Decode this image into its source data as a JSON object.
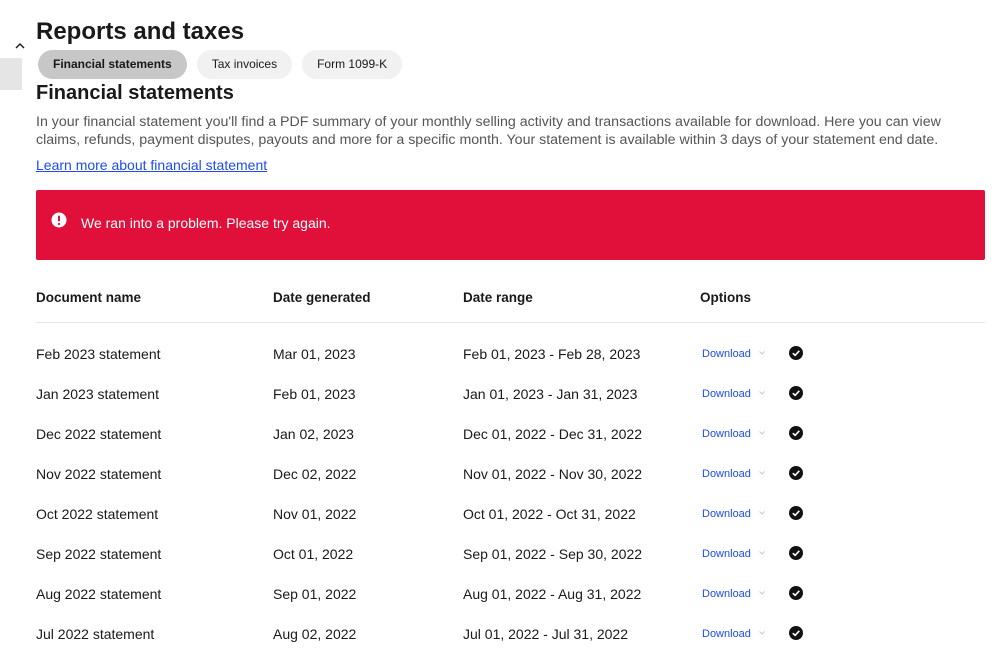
{
  "page": {
    "title": "Reports and taxes"
  },
  "tabs": [
    {
      "label": "Financial statements",
      "active": true
    },
    {
      "label": "Tax invoices",
      "active": false
    },
    {
      "label": "Form 1099-K",
      "active": false
    }
  ],
  "section": {
    "title": "Financial statements",
    "description": "In your financial statement you'll find a PDF summary of your monthly selling activity and transactions available for download. Here you can view claims, refunds, payment disputes, payouts and more for a specific month. Your statement is available within 3 days of your statement end date.",
    "learn_more": "Learn more about financial statement"
  },
  "error": {
    "message": "We ran into a problem. Please try again.",
    "color": "#e0103a"
  },
  "table": {
    "headers": {
      "document_name": "Document name",
      "date_generated": "Date generated",
      "date_range": "Date range",
      "options": "Options"
    },
    "rows": [
      {
        "name": "Feb 2023 statement",
        "generated": "Mar 01, 2023",
        "range": "Feb 01, 2023 - Feb 28, 2023",
        "action": "Download"
      },
      {
        "name": "Jan 2023 statement",
        "generated": "Feb 01, 2023",
        "range": "Jan 01, 2023 - Jan 31, 2023",
        "action": "Download"
      },
      {
        "name": "Dec 2022 statement",
        "generated": "Jan 02, 2023",
        "range": "Dec 01, 2022 - Dec 31, 2022",
        "action": "Download"
      },
      {
        "name": "Nov 2022 statement",
        "generated": "Dec 02, 2022",
        "range": "Nov 01, 2022 - Nov 30, 2022",
        "action": "Download"
      },
      {
        "name": "Oct 2022 statement",
        "generated": "Nov 01, 2022",
        "range": "Oct 01, 2022 - Oct 31, 2022",
        "action": "Download"
      },
      {
        "name": "Sep 2022 statement",
        "generated": "Oct 01, 2022",
        "range": "Sep 01, 2022 - Sep 30, 2022",
        "action": "Download"
      },
      {
        "name": "Aug 2022 statement",
        "generated": "Sep 01, 2022",
        "range": "Aug 01, 2022 - Aug 31, 2022",
        "action": "Download"
      },
      {
        "name": "Jul 2022 statement",
        "generated": "Aug 02, 2022",
        "range": "Jul 01, 2022 - Jul 31, 2022",
        "action": "Download"
      }
    ]
  },
  "icons": {
    "collapse": "chevron-up-icon",
    "alert": "alert-circle-icon",
    "download_menu": "chevron-down-icon",
    "status": "check-circle-icon"
  },
  "colors": {
    "link": "#1f4bf0",
    "active_tab": "#c7c7c7",
    "tab": "#f1f1f1"
  }
}
